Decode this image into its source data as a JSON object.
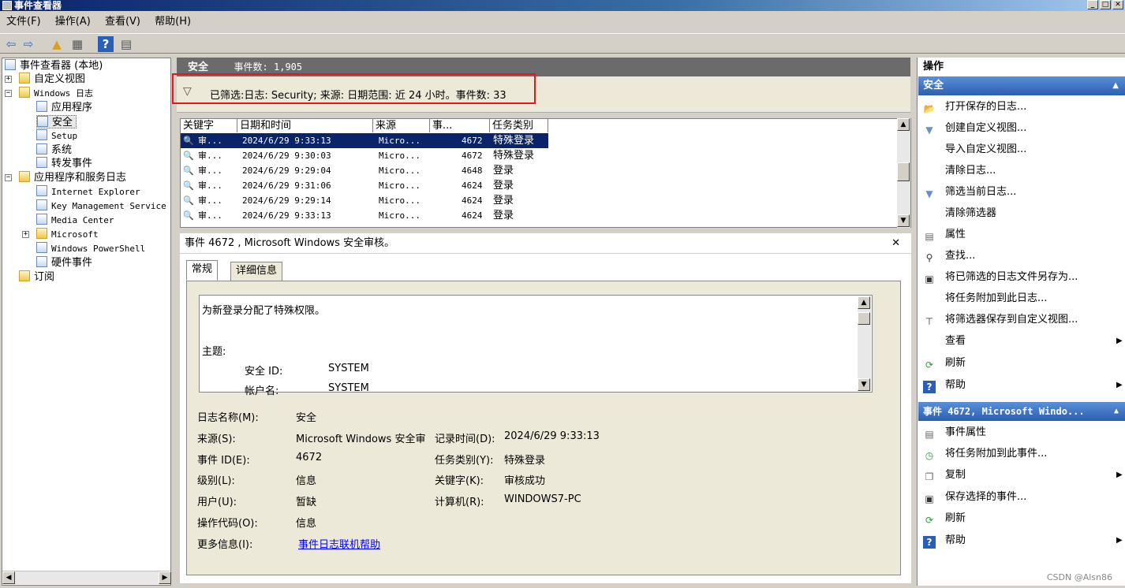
{
  "window": {
    "title": "事件查看器",
    "min": "_",
    "max": "□",
    "close": "✕"
  },
  "menu": [
    "文件(F)",
    "操作(A)",
    "查看(V)",
    "帮助(H)"
  ],
  "toolbar": {
    "back": "⇦",
    "forward": "⇨",
    "up": "▲",
    "view": "▦",
    "help": "?",
    "panel": "▤"
  },
  "tree": {
    "root": "事件查看器 (本地)",
    "custom_views": "自定义视图",
    "windows_logs": "Windows 日志",
    "application": "应用程序",
    "security": "安全",
    "setup": "Setup",
    "system": "系统",
    "forwarded": "转发事件",
    "app_services": "应用程序和服务日志",
    "ie": "Internet Explorer",
    "kms": "Key Management Service",
    "media_center": "Media Center",
    "microsoft": "Microsoft",
    "powershell": "Windows PowerShell",
    "hardware": "硬件事件",
    "subscriptions": "订阅"
  },
  "center": {
    "log_name": "安全",
    "event_count": "事件数: 1,905"
  },
  "filter": {
    "text": "已筛选:日志: Security; 来源: 日期范围: 近 24 小时。事件数: 33"
  },
  "columns": [
    "关键字",
    "日期和时间",
    "来源",
    "事...",
    "任务类别"
  ],
  "rows": [
    {
      "key": "审...",
      "date": "2024/6/29 9:33:13",
      "source": "Micro...",
      "id": "4672",
      "task": "特殊登录"
    },
    {
      "key": "审...",
      "date": "2024/6/29 9:30:03",
      "source": "Micro...",
      "id": "4672",
      "task": "特殊登录"
    },
    {
      "key": "审...",
      "date": "2024/6/29 9:29:04",
      "source": "Micro...",
      "id": "4648",
      "task": "登录"
    },
    {
      "key": "审...",
      "date": "2024/6/29 9:31:06",
      "source": "Micro...",
      "id": "4624",
      "task": "登录"
    },
    {
      "key": "审...",
      "date": "2024/6/29 9:29:14",
      "source": "Micro...",
      "id": "4624",
      "task": "登录"
    },
    {
      "key": "审...",
      "date": "2024/6/29 9:33:13",
      "source": "Micro...",
      "id": "4624",
      "task": "登录"
    }
  ],
  "detail": {
    "header": "事件 4672 , Microsoft Windows 安全审核。",
    "close": "✕",
    "tab_general": "常规",
    "tab_details": "详细信息",
    "desc_line1": "为新登录分配了特殊权限。",
    "desc_subject": "主题:",
    "desc_sid_label": "安全 ID:",
    "desc_sid_value": "SYSTEM",
    "desc_acct_label": "帐户名:",
    "desc_acct_value": "SYSTEM",
    "log_name_label": "日志名称(M):",
    "log_name_value": "安全",
    "source_label": "来源(S):",
    "source_value": "Microsoft Windows 安全审",
    "recorded_label": "记录时间(D):",
    "recorded_value": "2024/6/29 9:33:13",
    "event_id_label": "事件 ID(E):",
    "event_id_value": "4672",
    "task_label": "任务类别(Y):",
    "task_value": "特殊登录",
    "level_label": "级别(L):",
    "level_value": "信息",
    "keywords_label": "关键字(K):",
    "keywords_value": "审核成功",
    "user_label": "用户(U):",
    "user_value": "暂缺",
    "computer_label": "计算机(R):",
    "computer_value": "WINDOWS7-PC",
    "opcode_label": "操作代码(O):",
    "opcode_value": "信息",
    "more_info_label": "更多信息(I):",
    "more_info_link": "事件日志联机帮助"
  },
  "actions": {
    "header": "操作",
    "group1": "安全",
    "group1_items": [
      "打开保存的日志...",
      "创建自定义视图...",
      "导入自定义视图...",
      "清除日志...",
      "筛选当前日志...",
      "清除筛选器",
      "属性",
      "查找...",
      "将已筛选的日志文件另存为...",
      "将任务附加到此日志...",
      "将筛选器保存到自定义视图...",
      "查看",
      "刷新",
      "帮助"
    ],
    "group2": "事件 4672, Microsoft Windo...",
    "group2_items": [
      "事件属性",
      "将任务附加到此事件...",
      "复制",
      "保存选择的事件...",
      "刷新",
      "帮助"
    ]
  },
  "watermark": "CSDN @Alsn86"
}
